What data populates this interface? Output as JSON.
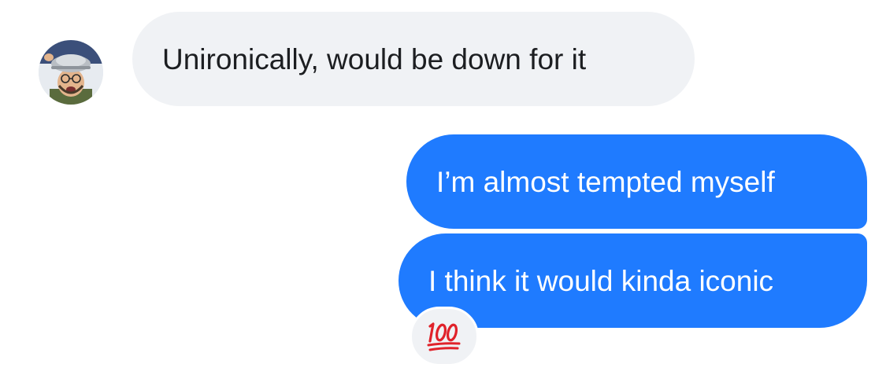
{
  "messages": {
    "incoming": {
      "text": "Unironically, would be down for it",
      "avatar_icon": "person-with-colander-hat-avatar"
    },
    "outgoing": [
      {
        "text": "I’m almost tempted myself"
      },
      {
        "text": "I think it would kinda iconic"
      }
    ]
  },
  "reaction": {
    "emoji_name": "hundred-points-icon",
    "emoji": "💯"
  },
  "colors": {
    "incoming_bubble": "#f0f2f5",
    "outgoing_bubble": "#1f7bff",
    "reaction_red": "#e0222a"
  }
}
